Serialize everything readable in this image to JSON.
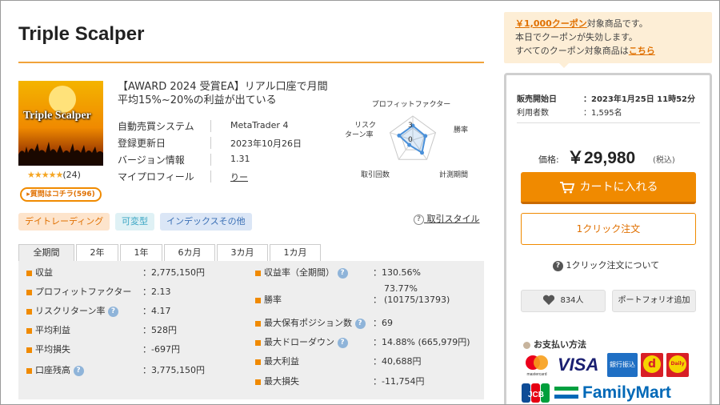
{
  "product": {
    "title": "Triple Scalper",
    "thumbnail_text": "Triple Scalper",
    "rating_stars": "★★★★★",
    "rating_count": "(24)",
    "review_button": "▸質問はコチラ(596)",
    "headline": "【AWARD 2024 受賞EA】リアル口座で月間平均15%~20%の利益が出ている"
  },
  "specs": [
    {
      "label": "自動売買システム",
      "value": "MetaTrader 4"
    },
    {
      "label": "登録更新日",
      "value": "2023年10月26日"
    },
    {
      "label": "バージョン情報",
      "value": "1.31"
    },
    {
      "label": "マイプロフィール",
      "value": "りー"
    }
  ],
  "radar": {
    "labels": {
      "profit_factor": "プロフィットファクター",
      "win_rate": "勝率",
      "period": "計測期間",
      "trades": "取引回数",
      "risk_return": "リスクターン率"
    },
    "scale_labels": [
      "3",
      "0"
    ],
    "values": [
      0.6,
      0.55,
      0.65,
      0.25,
      0.6
    ],
    "line_color": "#4a90d9"
  },
  "tags": [
    "デイトレーディング",
    "可変型",
    "インデックスその他"
  ],
  "trade_style_link": "取引スタイル",
  "tabs": [
    "全期間",
    "2年",
    "1年",
    "6カ月",
    "3カ月",
    "1カ月"
  ],
  "active_tab": "全期間",
  "stats_left": [
    {
      "label": "収益",
      "value": "2,775,150円",
      "help": false
    },
    {
      "label": "プロフィットファクター",
      "value": "2.13",
      "help": false
    },
    {
      "label": "リスクリターン率",
      "value": "4.17",
      "help": true
    },
    {
      "label": "平均利益",
      "value": "528円",
      "help": false
    },
    {
      "label": "平均損失",
      "value": "-697円",
      "help": false
    },
    {
      "label": "口座残高",
      "value": "3,775,150円",
      "help": true
    }
  ],
  "stats_right": [
    {
      "label": "収益率（全期間）",
      "value": "130.56%",
      "value2": "",
      "help": true
    },
    {
      "label": "勝率",
      "value": "73.77%",
      "value2": "(10175/13793)",
      "help": false
    },
    {
      "label": "最大保有ポジション数",
      "value": "69",
      "value2": "",
      "help": true
    },
    {
      "label": "最大ドローダウン",
      "value": "14.88% (665,979円)",
      "value2": "",
      "help": true
    },
    {
      "label": "最大利益",
      "value": "40,688円",
      "value2": "",
      "help": false
    },
    {
      "label": "最大損失",
      "value": "-11,754円",
      "value2": "",
      "help": false
    }
  ],
  "coupon": {
    "line1_highlight": "￥1,000クーポン",
    "line1_rest": "対象商品です。",
    "line2": "本日でクーポンが失効します。",
    "line3_text": "すべてのクーポン対象商品は",
    "line3_link": "こちら"
  },
  "sidebar": {
    "sale_start_label": "販売開始日",
    "sale_start_value": "2023年1月25日 11時52分",
    "users_label": "利用者数",
    "users_value": "1,595名",
    "colon": "：",
    "price_label": "価格:",
    "price": "￥29,980",
    "tax": "(税込)",
    "cart_button": "カートに入れる",
    "oneclick_button": "1クリック注文",
    "oneclick_about": "1クリック注文について",
    "favorite_count": "834人",
    "portfolio_button": "ポートフォリオ追加",
    "payment_title": "お支払い方法",
    "payments": {
      "mastercard": "mastercard",
      "visa": "VISA",
      "bank": "銀行振込",
      "docomo": "d",
      "daily": "Daily",
      "jcb": "JCB",
      "familymart": "FamilyMart"
    }
  },
  "colors": {
    "accent": "#f08a00",
    "coupon_bg": "#fdeed6",
    "stats_bg": "#eeeeee"
  }
}
